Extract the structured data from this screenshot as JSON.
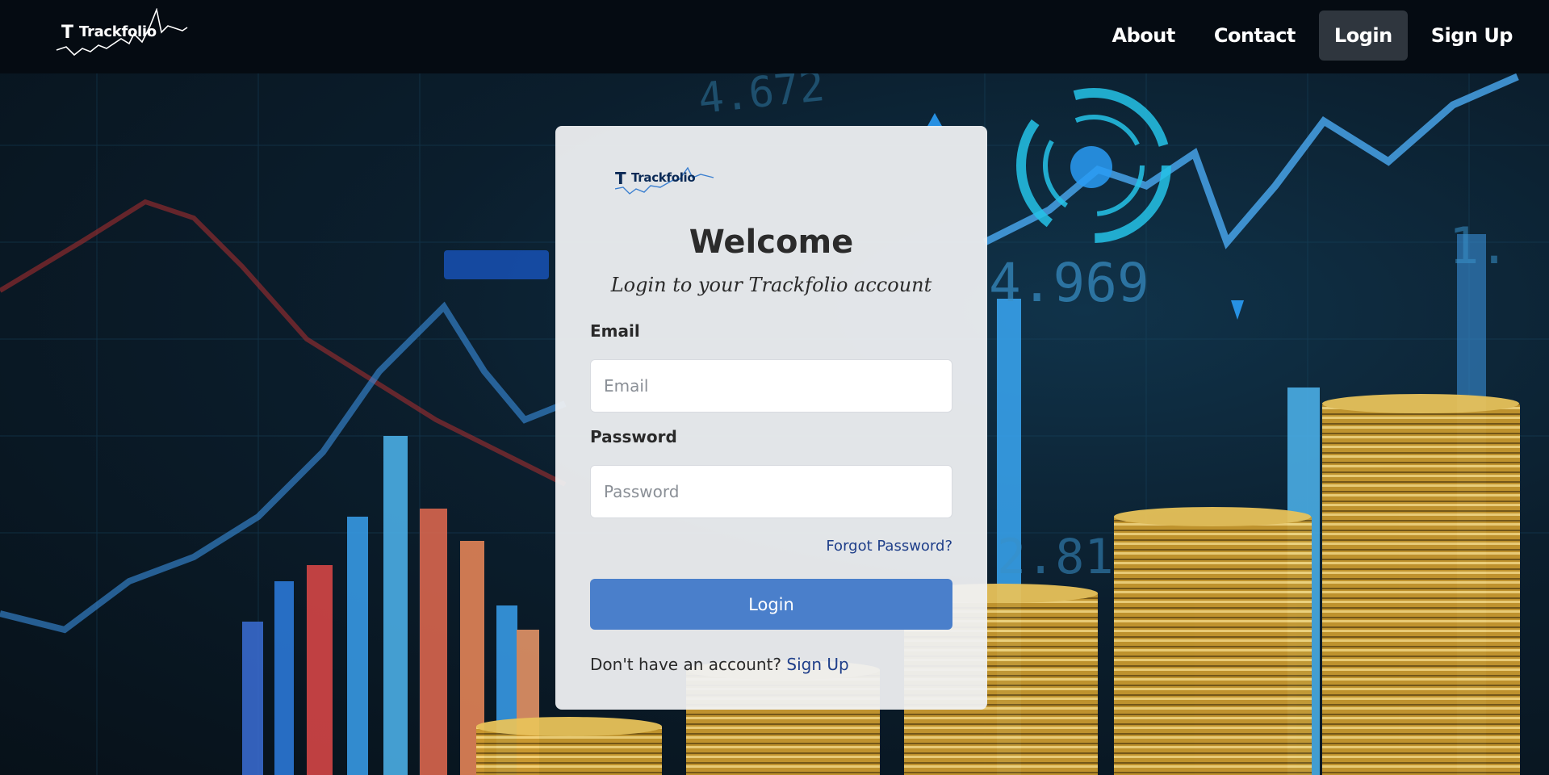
{
  "brand": {
    "name": "Trackfolio",
    "mark": "T"
  },
  "nav": {
    "items": [
      {
        "label": "About"
      },
      {
        "label": "Contact"
      },
      {
        "label": "Login",
        "active": true
      },
      {
        "label": "Sign Up"
      }
    ]
  },
  "card": {
    "logo_name": "Trackfolio",
    "logo_mark": "T",
    "heading": "Welcome",
    "subtitle": "Login to your Trackfolio account",
    "email": {
      "label": "Email",
      "placeholder": "Email",
      "value": ""
    },
    "password": {
      "label": "Password",
      "placeholder": "Password",
      "value": ""
    },
    "forgot_label": "Forgot Password?",
    "login_label": "Login",
    "signup_prompt": "Don't have an account?",
    "signup_link": "Sign Up"
  },
  "background": {
    "numbers": [
      "4.672",
      "4.969",
      "2.81",
      "1."
    ]
  },
  "colors": {
    "navbar": "#050b12",
    "accent": "#4a7fcb",
    "link": "#1f3f8a",
    "active_nav": "#2f363e"
  }
}
